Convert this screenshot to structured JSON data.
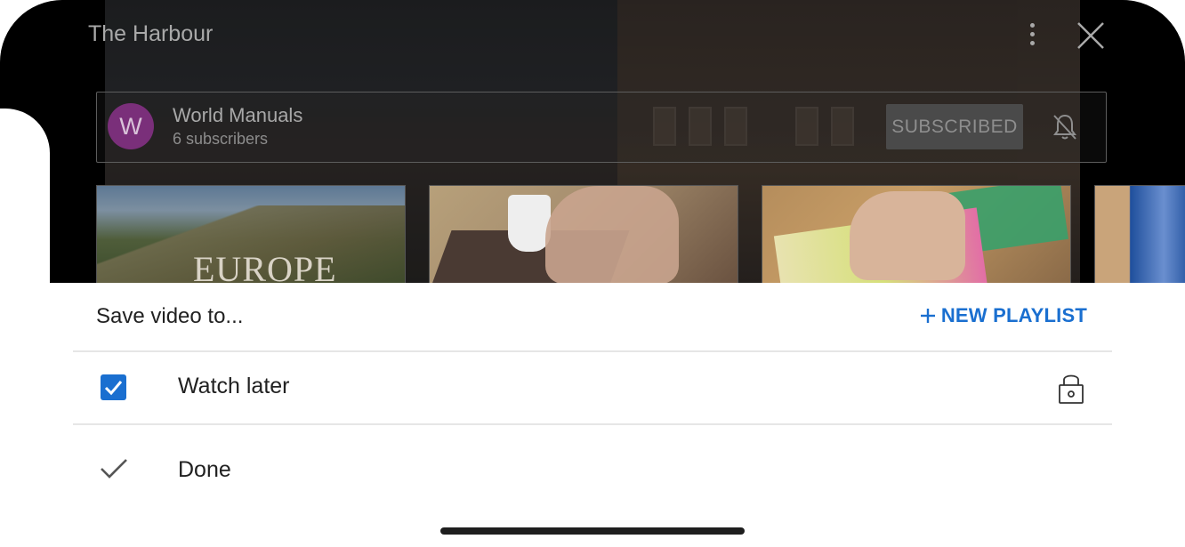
{
  "player": {
    "title": "The Harbour",
    "channel": {
      "avatar_letter": "W",
      "name": "World Manuals",
      "subscribers": "6 subscribers",
      "subscribe_label": "SUBSCRIBED"
    },
    "thumbnails": [
      {
        "overlay_text": "EUROPE"
      },
      {
        "overlay_text": ""
      },
      {
        "overlay_text": ""
      },
      {
        "overlay_text": ""
      }
    ]
  },
  "sheet": {
    "title": "Save video to...",
    "new_playlist_label": "NEW PLAYLIST",
    "playlists": [
      {
        "label": "Watch later",
        "checked": true,
        "privacy_icon": "lock-icon"
      }
    ],
    "done_label": "Done"
  },
  "colors": {
    "accent": "#1a6fd0",
    "avatar": "#7a2f7a"
  }
}
